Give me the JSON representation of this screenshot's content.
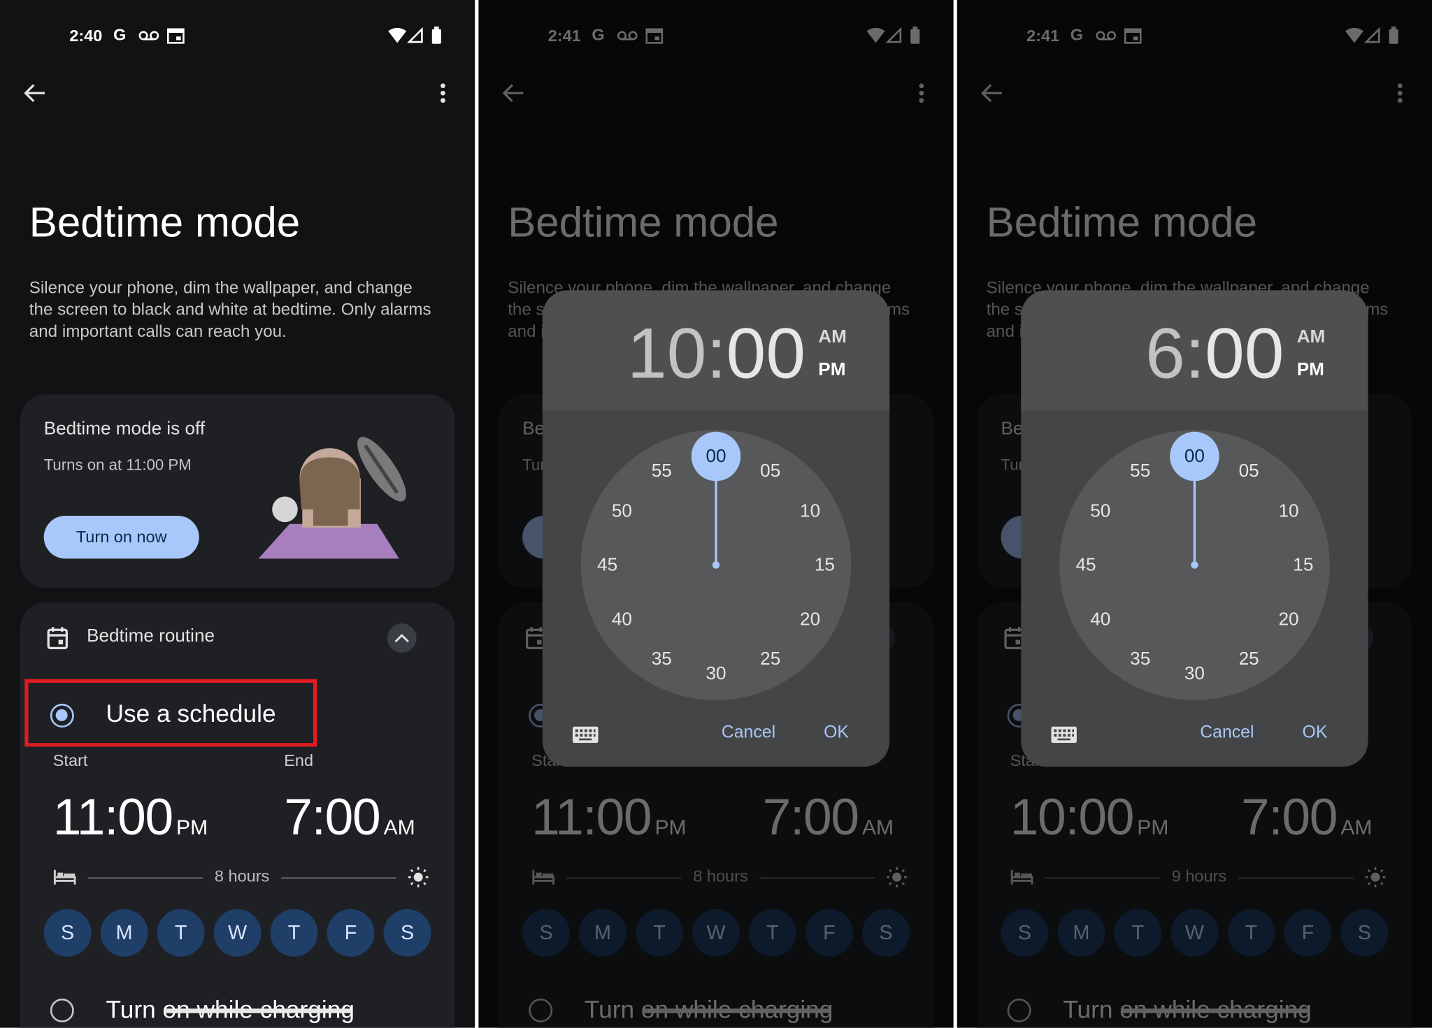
{
  "colors": {
    "accent": "#a8c7fa",
    "day_chip": "#1f3e68",
    "highlight_box": "#e01c24",
    "background": "#111214"
  },
  "panels": [
    {
      "status_time": "2:40",
      "title": "Bedtime mode",
      "description": "Silence your phone, dim the wallpaper, and change the screen to black and white at bedtime. Only alarms and important calls can reach you.",
      "status_card": {
        "title": "Bedtime mode is off",
        "subtitle": "Turns on at 11:00 PM",
        "button": "Turn on now"
      },
      "routine": {
        "title": "Bedtime routine",
        "option_schedule": "Use a schedule",
        "schedule_selected": true,
        "start_label": "Start",
        "end_label": "End",
        "start_time": "11:00",
        "start_period": "PM",
        "end_time": "7:00",
        "end_period": "AM",
        "duration": "8 hours",
        "days": [
          "S",
          "M",
          "T",
          "W",
          "T",
          "F",
          "S"
        ],
        "option_charging": "Turn on while charging"
      },
      "dialog": null,
      "highlighted": true
    },
    {
      "status_time": "2:41",
      "title": "Bedtime mode",
      "description": "Silence your phone, dim the wallpaper, and change the screen to black and white at bedtime. Only alarms and important calls can reach you.",
      "status_card": {
        "title": "Bedtime mode is off",
        "subtitle": "Turns on at 11:00 PM",
        "button": "Turn on now"
      },
      "routine": {
        "title": "Bedtime routine",
        "option_schedule": "Use a schedule",
        "schedule_selected": true,
        "start_label": "Start",
        "end_label": "End",
        "start_time": "11:00",
        "start_period": "PM",
        "end_time": "7:00",
        "end_period": "AM",
        "duration": "8 hours",
        "days": [
          "S",
          "M",
          "T",
          "W",
          "T",
          "F",
          "S"
        ],
        "option_charging": "Turn on while charging"
      },
      "dialog": {
        "hour": "10",
        "separator": ":",
        "minute": "00",
        "am": "AM",
        "pm": "PM",
        "selected_period": "PM",
        "selected_minute": "00",
        "cancel": "Cancel",
        "ok": "OK"
      },
      "highlighted": false
    },
    {
      "status_time": "2:41",
      "title": "Bedtime mode",
      "description": "Silence your phone, dim the wallpaper, and change the screen to black and white at bedtime. Only alarms and important calls can reach you.",
      "status_card": {
        "title": "Bedtime mode is off",
        "subtitle": "Turns on at 11:00 PM",
        "button": "Turn on now"
      },
      "routine": {
        "title": "Bedtime routine",
        "option_schedule": "Use a schedule",
        "schedule_selected": true,
        "start_label": "Start",
        "end_label": "End",
        "start_time": "10:00",
        "start_period": "PM",
        "end_time": "7:00",
        "end_period": "AM",
        "duration": "9 hours",
        "days": [
          "S",
          "M",
          "T",
          "W",
          "T",
          "F",
          "S"
        ],
        "option_charging": "Turn on while charging"
      },
      "dialog": {
        "hour": "6",
        "separator": ":",
        "minute": "00",
        "am": "AM",
        "pm": "PM",
        "selected_period": "PM",
        "selected_minute": "00",
        "cancel": "Cancel",
        "ok": "OK"
      },
      "highlighted": false
    }
  ],
  "dial_labels": [
    "00",
    "05",
    "10",
    "15",
    "20",
    "25",
    "30",
    "35",
    "40",
    "45",
    "50",
    "55"
  ]
}
